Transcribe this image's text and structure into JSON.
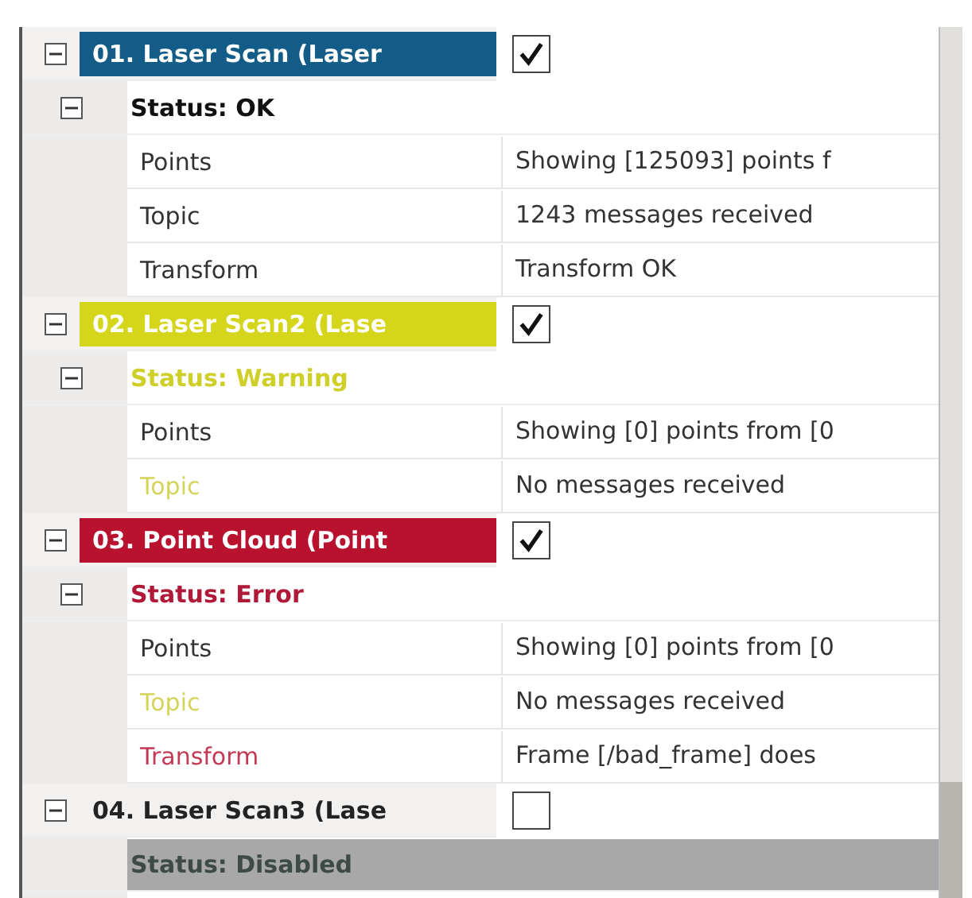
{
  "displays": [
    {
      "label": "01. Laser Scan (Laser",
      "kind": "ok",
      "checked": true,
      "status_text": "Status: OK",
      "properties": [
        {
          "name": "Points",
          "value": "Showing [125093] points f",
          "kind": "ok"
        },
        {
          "name": "Topic",
          "value": "1243 messages received",
          "kind": "ok"
        },
        {
          "name": "Transform",
          "value": "Transform OK",
          "kind": "ok"
        }
      ]
    },
    {
      "label": "02. Laser Scan2 (Lase",
      "kind": "warning",
      "checked": true,
      "status_text": "Status: Warning",
      "properties": [
        {
          "name": "Points",
          "value": "Showing [0] points from [0",
          "kind": "ok"
        },
        {
          "name": "Topic",
          "value": "No messages received",
          "kind": "warning"
        }
      ]
    },
    {
      "label": "03. Point Cloud (Point",
      "kind": "error",
      "checked": true,
      "status_text": "Status: Error",
      "properties": [
        {
          "name": "Points",
          "value": "Showing [0] points from [0",
          "kind": "ok"
        },
        {
          "name": "Topic",
          "value": "No messages received",
          "kind": "warning"
        },
        {
          "name": "Transform",
          "value": "Frame [/bad_frame] does",
          "kind": "error"
        }
      ]
    },
    {
      "label": "04. Laser Scan3 (Lase",
      "kind": "disabled",
      "checked": false,
      "status_text": "Status: Disabled"
    }
  ]
}
